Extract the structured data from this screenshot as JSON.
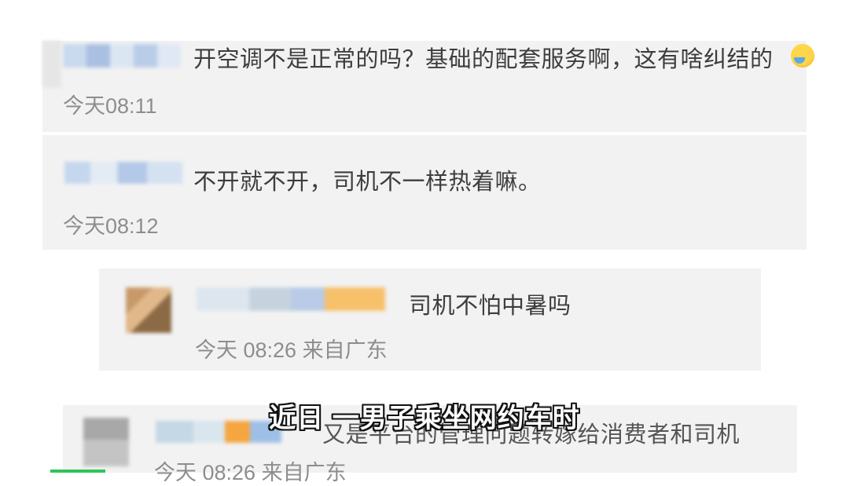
{
  "comments": [
    {
      "text": "开空调不是正常的吗？基础的配套服务啊，这有啥纠结的",
      "meta": "今天08:11",
      "has_emoji": true
    },
    {
      "text": "不开就不开，司机不一样热着嘛。",
      "meta": "今天08:12"
    }
  ],
  "replies": [
    {
      "text": "司机不怕中暑吗",
      "meta": "今天 08:26 来自广东"
    },
    {
      "text": "又是平台的管理问题转嫁给消费者和司机",
      "meta": "今天 08:26 来自广东"
    }
  ],
  "caption": "近日 一男子乘坐网约车时",
  "colors": {
    "card_bg": "#f2f2f2",
    "text": "#3d3d3d",
    "meta": "#8d8d8d",
    "caption_text": "#ffffff",
    "caption_outline": "#111111",
    "scroll_hint": "#2ec45a"
  }
}
